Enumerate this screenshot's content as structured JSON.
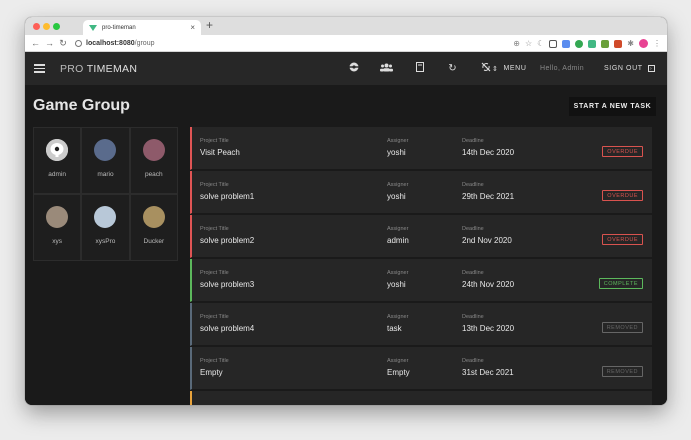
{
  "browser": {
    "tab_title": "pro-timeman",
    "new_tab": "+",
    "url_host": "localhost:8080",
    "url_path": "/group"
  },
  "appbar": {
    "brand_prefix": "PRO",
    "brand_name": "TIMEMAN",
    "menu_label": "MENU",
    "greeting": "Hello, Admin",
    "signout_label": "SIGN OUT"
  },
  "page": {
    "title": "Game Group",
    "new_task_label": "START A NEW TASK"
  },
  "members": [
    {
      "name": "admin",
      "color": "#f2f2f2"
    },
    {
      "name": "mario",
      "color": "#5a6b8c"
    },
    {
      "name": "peach",
      "color": "#8e5a6a"
    },
    {
      "name": "xys",
      "color": "#9a8a7a"
    },
    {
      "name": "xysPro",
      "color": "#b8c8d8"
    },
    {
      "name": "Ducker",
      "color": "#a89060"
    }
  ],
  "task_labels": {
    "title": "Project Title",
    "assigner": "Assigner",
    "deadline": "Deadline"
  },
  "tasks": [
    {
      "title": "Visit Peach",
      "assigner": "yoshi",
      "deadline": "14th Dec 2020",
      "status": "OVERDUE",
      "accent": "#e05555",
      "status_color": "#d9534f"
    },
    {
      "title": "solve problem1",
      "assigner": "yoshi",
      "deadline": "29th Dec 2021",
      "status": "OVERDUE",
      "accent": "#e05555",
      "status_color": "#d9534f"
    },
    {
      "title": "solve problem2",
      "assigner": "admin",
      "deadline": "2nd Nov 2020",
      "status": "OVERDUE",
      "accent": "#e05555",
      "status_color": "#d9534f"
    },
    {
      "title": "solve problem3",
      "assigner": "yoshi",
      "deadline": "24th Nov 2020",
      "status": "COMPLETE",
      "accent": "#5cb85c",
      "status_color": "#5cb85c"
    },
    {
      "title": "solve problem4",
      "assigner": "task",
      "deadline": "13th Dec 2020",
      "status": "REMOVED",
      "accent": "#5a6a7a",
      "status_color": "#666666"
    },
    {
      "title": "Empty",
      "assigner": "Empty",
      "deadline": "31st Dec 2021",
      "status": "REMOVED",
      "accent": "#5a6a7a",
      "status_color": "#666666"
    },
    {
      "title": "",
      "assigner": "",
      "deadline": "",
      "status": "",
      "accent": "#e8a33c",
      "status_color": "#e8a33c"
    }
  ]
}
